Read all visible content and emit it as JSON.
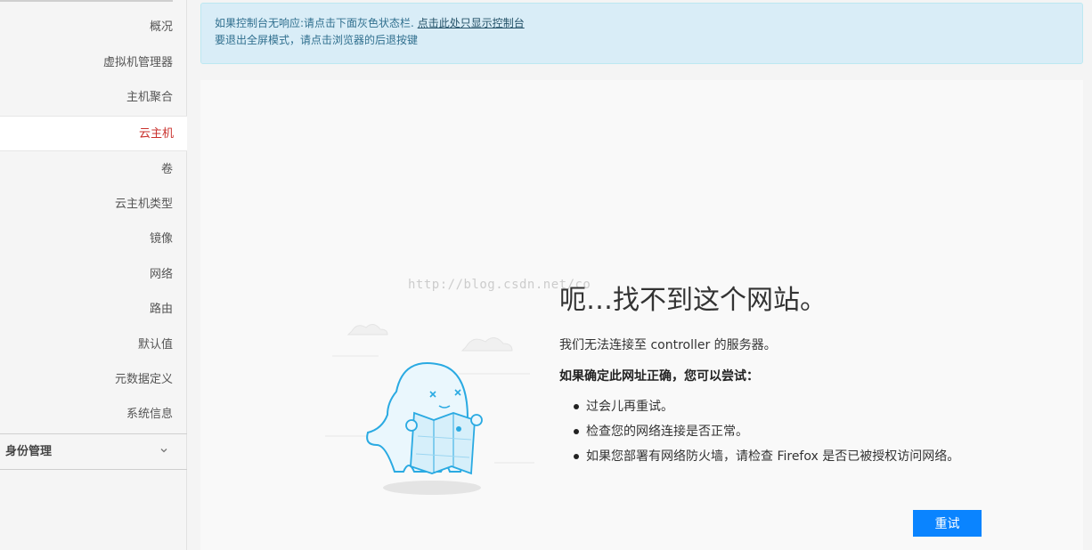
{
  "sidebar": {
    "items": [
      {
        "label": "概况"
      },
      {
        "label": "虚拟机管理器"
      },
      {
        "label": "主机聚合"
      },
      {
        "label": "云主机"
      },
      {
        "label": "卷"
      },
      {
        "label": "云主机类型"
      },
      {
        "label": "镜像"
      },
      {
        "label": "网络"
      },
      {
        "label": "路由"
      },
      {
        "label": "默认值"
      },
      {
        "label": "元数据定义"
      },
      {
        "label": "系统信息"
      }
    ],
    "active_index": 3,
    "identity_section": {
      "label": "身份管理",
      "icon": "chevron-down-icon"
    }
  },
  "alert": {
    "line1_text": "如果控制台无响应:请点击下面灰色状态栏.",
    "line1_link": "点击此处只显示控制台",
    "line2_text": "要退出全屏模式，请点击浏览器的后退按键"
  },
  "error_page": {
    "watermark": "http://blog.csdn.net/co",
    "title": "呃…找不到这个网站。",
    "description": "我们无法连接至 controller 的服务器。",
    "try_heading": "如果确定此网址正确，您可以尝试：",
    "suggestions": [
      "过会儿再重试。",
      "检查您的网络连接是否正常。",
      "如果您部署有网络防火墙，请检查 Firefox 是否已被授权访问网络。"
    ],
    "retry_label": "重试"
  },
  "colors": {
    "active_nav": "#c9302c",
    "alert_bg": "#d9edf7",
    "retry_button": "#0a84ff"
  }
}
